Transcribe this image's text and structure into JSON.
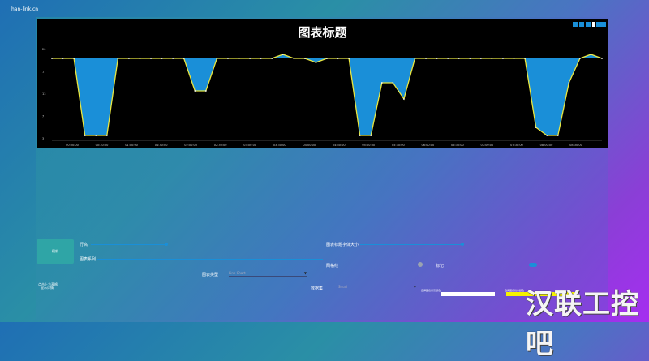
{
  "site": {
    "host": "han-link.cn"
  },
  "chart": {
    "title": "图表标题"
  },
  "chart_data": {
    "type": "area",
    "title": "图表标题",
    "y_ticks": [
      "20",
      "17",
      "13",
      "7",
      "3"
    ],
    "x_ticks": [
      "00:00:00",
      "00:30:00",
      "01:00:00",
      "01:30:00",
      "02:00:00",
      "02:30:00",
      "03:00:00",
      "03:30:00",
      "04:00:00",
      "04:30:00",
      "05:00:00",
      "05:30:00",
      "06:00:00",
      "06:30:00",
      "07:00:00",
      "07:30:00",
      "08:00:00",
      "08:30:00"
    ],
    "x": [
      0,
      2,
      4,
      6,
      8,
      10,
      12,
      14,
      16,
      18,
      20,
      22,
      24,
      26,
      28,
      30,
      32,
      34,
      36,
      38,
      40,
      42,
      44,
      46,
      48,
      50,
      52,
      54,
      56,
      58,
      60,
      62,
      64,
      66,
      68,
      70,
      72,
      74,
      76,
      78,
      80,
      82,
      84,
      86,
      88,
      90,
      92,
      94,
      96,
      98,
      100
    ],
    "series": [
      {
        "values": [
          20,
          20,
          20,
          1,
          1,
          1,
          20,
          20,
          20,
          20,
          20,
          20,
          20,
          12,
          12,
          20,
          20,
          20,
          20,
          20,
          20,
          21,
          20,
          20,
          19,
          20,
          20,
          20,
          1,
          1,
          14,
          14,
          10,
          20,
          20,
          20,
          20,
          20,
          20,
          20,
          20,
          20,
          20,
          20,
          3,
          1,
          1,
          14,
          20,
          21,
          20
        ]
      }
    ],
    "baseline": 20,
    "ylim": [
      0,
      22
    ],
    "grid": false,
    "colors": {
      "fill": "#1a8fd8",
      "line": "#e8e640",
      "background": "#000000"
    }
  },
  "controls": {
    "main_button": "刷新",
    "row_label": "行高",
    "series_label": "图表系列",
    "font_size_label": "图表标题字体大小",
    "animation_label": "网格线",
    "marker_label": "标记",
    "chart_type_label": "图表类型",
    "chart_type_value": "Line Chart",
    "zoom_label": "数据集",
    "zoom_value": "Small",
    "left_note_1": "点击上方表格",
    "left_note_2": "显示详情",
    "color_note_1": "选择图表背景颜色",
    "color_note_2": "选择图表线条颜色"
  },
  "watermark": "汉联工控吧"
}
